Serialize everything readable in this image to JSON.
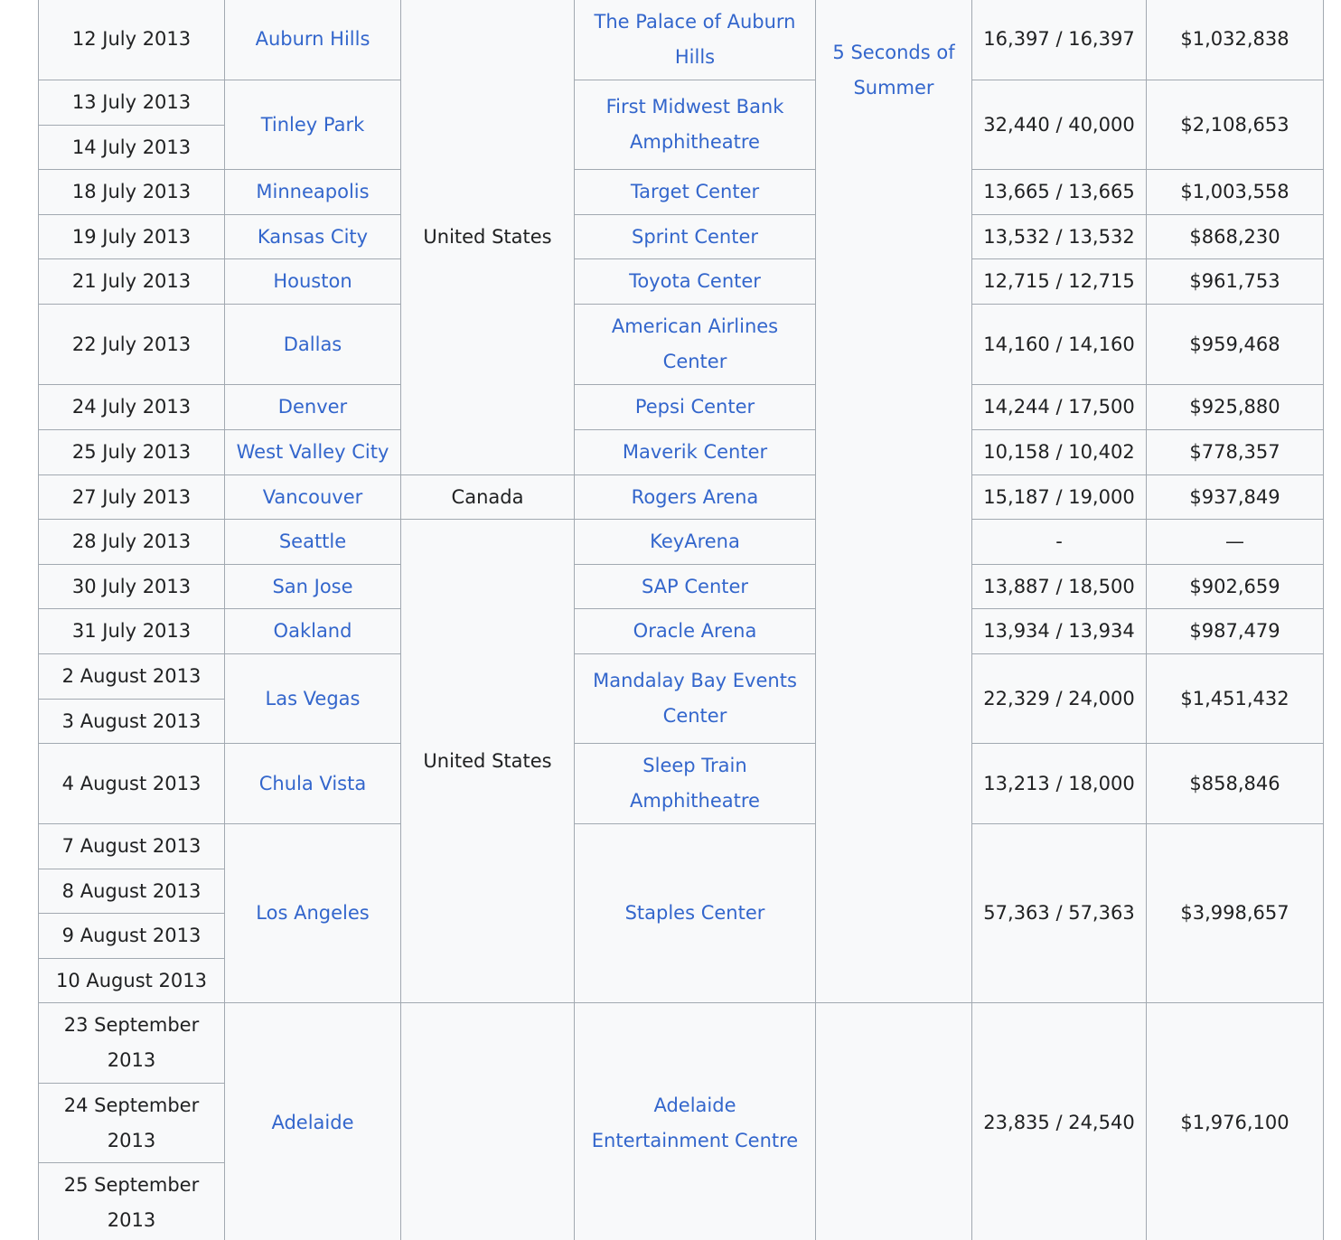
{
  "colors": {
    "link": "#3366cc",
    "text": "#202122",
    "border": "#a2a9b1",
    "cell_bg": "#f8f9fa"
  },
  "rows": [
    {
      "date": "12 July 2013",
      "city": "Auburn Hills",
      "country": "United States",
      "venue": "The Palace of Auburn Hills",
      "opening_act": "5 Seconds of Summer",
      "attendance": "16,397 / 16,397",
      "revenue": "$1,032,838"
    },
    {
      "date": "13 July 2013",
      "city": "Tinley Park",
      "venue": "First Midwest Bank Amphitheatre",
      "attendance": "32,440 / 40,000",
      "revenue": "$2,108,653"
    },
    {
      "date": "14 July 2013"
    },
    {
      "date": "18 July 2013",
      "city": "Minneapolis",
      "venue": "Target Center",
      "attendance": "13,665 / 13,665",
      "revenue": "$1,003,558"
    },
    {
      "date": "19 July 2013",
      "city": "Kansas City",
      "venue": "Sprint Center",
      "attendance": "13,532 / 13,532",
      "revenue": "$868,230"
    },
    {
      "date": "21 July 2013",
      "city": "Houston",
      "venue": "Toyota Center",
      "attendance": "12,715 / 12,715",
      "revenue": "$961,753"
    },
    {
      "date": "22 July 2013",
      "city": "Dallas",
      "venue": "American Airlines Center",
      "attendance": "14,160 / 14,160",
      "revenue": "$959,468"
    },
    {
      "date": "24 July 2013",
      "city": "Denver",
      "venue": "Pepsi Center",
      "attendance": "14,244 / 17,500",
      "revenue": "$925,880"
    },
    {
      "date": "25 July 2013",
      "city": "West Valley City",
      "venue": "Maverik Center",
      "attendance": "10,158 / 10,402",
      "revenue": "$778,357"
    },
    {
      "date": "27 July 2013",
      "city": "Vancouver",
      "country": "Canada",
      "venue": "Rogers Arena",
      "attendance": "15,187 / 19,000",
      "revenue": "$937,849"
    },
    {
      "date": "28 July 2013",
      "city": "Seattle",
      "country": "United States",
      "venue": "KeyArena",
      "attendance": "-",
      "revenue": "—"
    },
    {
      "date": "30 July 2013",
      "city": "San Jose",
      "venue": "SAP Center",
      "attendance": "13,887 / 18,500",
      "revenue": "$902,659"
    },
    {
      "date": "31 July 2013",
      "city": "Oakland",
      "venue": "Oracle Arena",
      "attendance": "13,934 / 13,934",
      "revenue": "$987,479"
    },
    {
      "date": "2 August 2013",
      "city": "Las Vegas",
      "venue": "Mandalay Bay Events Center",
      "attendance": "22,329 / 24,000",
      "revenue": "$1,451,432"
    },
    {
      "date": "3 August 2013"
    },
    {
      "date": "4 August 2013",
      "city": "Chula Vista",
      "venue": "Sleep Train Amphitheatre",
      "attendance": "13,213 / 18,000",
      "revenue": "$858,846"
    },
    {
      "date": "7 August 2013",
      "city": "Los Angeles",
      "venue": "Staples Center",
      "attendance": "57,363 / 57,363",
      "revenue": "$3,998,657"
    },
    {
      "date": "8 August 2013"
    },
    {
      "date": "9 August 2013"
    },
    {
      "date": "10 August 2013"
    },
    {
      "date": "23 September 2013",
      "city": "Adelaide",
      "country": "",
      "venue": "Adelaide Entertainment Centre",
      "opening_act": "",
      "attendance": "23,835 / 24,540",
      "revenue": "$1,976,100"
    },
    {
      "date": "24 September 2013"
    },
    {
      "date": "25 September 2013"
    }
  ]
}
